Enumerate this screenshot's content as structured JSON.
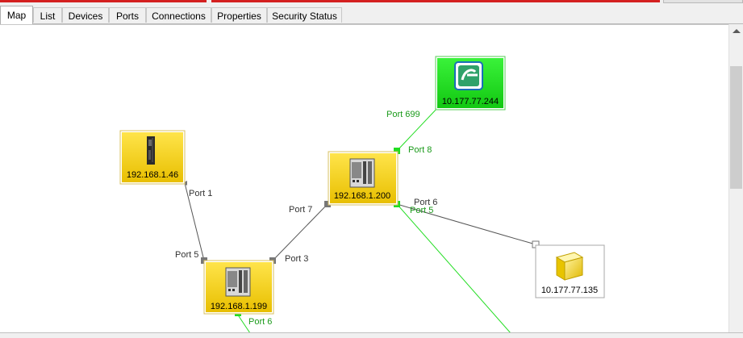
{
  "tabs": [
    {
      "label": "Map",
      "active": true
    },
    {
      "label": "List"
    },
    {
      "label": "Devices"
    },
    {
      "label": "Ports"
    },
    {
      "label": "Connections"
    },
    {
      "label": "Properties"
    },
    {
      "label": "Security Status"
    }
  ],
  "nodes": {
    "cpu": {
      "ip": "192.168.1.46",
      "icon": "plc-controller-icon",
      "status_color": "#f4cf00"
    },
    "sw200": {
      "ip": "192.168.1.200",
      "icon": "industrial-switch-icon",
      "status_color": "#f4cf00"
    },
    "sw199": {
      "ip": "192.168.1.199",
      "icon": "industrial-switch-icon",
      "status_color": "#f4cf00"
    },
    "gw": {
      "ip": "10.177.77.244",
      "icon": "gateway-logo-icon",
      "status_color": "#1ede1e"
    },
    "unk": {
      "ip": "10.177.77.135",
      "icon": "unknown-device-cube-icon",
      "status_color": "#ffffff"
    }
  },
  "ports": {
    "cpu_port1": "Port 1",
    "sw199_port5": "Port 5",
    "sw199_port3": "Port 3",
    "sw199_port6": "Port 6",
    "sw200_port7": "Port 7",
    "sw200_port8": "Port 8",
    "sw200_port6": "Port 6",
    "sw200_port5": "Port 5",
    "gw_port699": "Port 699"
  },
  "colors": {
    "link_active": "#22dd22",
    "link_inactive": "#555555",
    "node_yellow": "#f4cf00",
    "node_green": "#1ede1e"
  }
}
